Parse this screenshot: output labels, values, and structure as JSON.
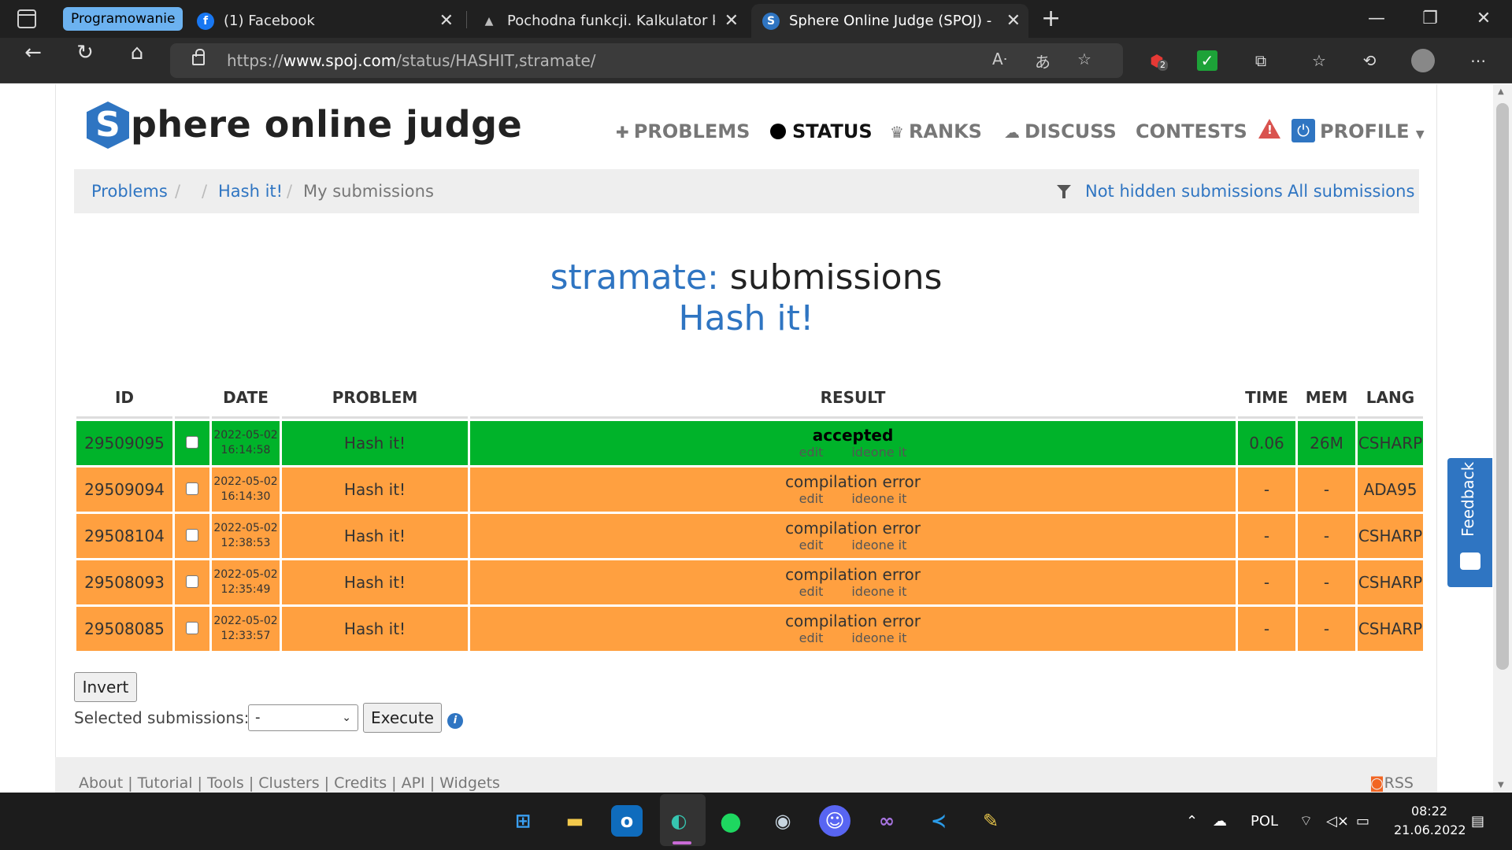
{
  "browser": {
    "tab_group": "Programowanie",
    "tabs": [
      {
        "title": "(1) Facebook",
        "icon": "facebook-icon"
      },
      {
        "title": "Pochodna funkcji. Kalkulator krok",
        "icon": "triangle-icon"
      },
      {
        "title": "Sphere Online Judge (SPOJ) - Sta",
        "icon": "spoj-icon",
        "active": true
      }
    ],
    "url_prefix": "https://",
    "url_domain": "www.spoj.com",
    "url_path": "/status/HASHIT,stramate/",
    "extension_badge": "2"
  },
  "site": {
    "logo_letter": "S",
    "logo_text": "phere online judge",
    "nav": {
      "problems": "PROBLEMS",
      "status": "STATUS",
      "ranks": "RANKS",
      "discuss": "DISCUSS",
      "contests": "CONTESTS",
      "profile": "PROFILE"
    }
  },
  "breadcrumb": {
    "problems": "Problems",
    "sep": "/",
    "problem": "Hash it!",
    "current": "My submissions",
    "not_hidden": "Not hidden submissions",
    "all": "All submissions"
  },
  "heading": {
    "user": "stramate:",
    "suffix": "submissions",
    "problem": "Hash it!"
  },
  "table": {
    "headers": {
      "id": "ID",
      "date": "DATE",
      "problem": "PROBLEM",
      "result": "RESULT",
      "time": "TIME",
      "mem": "MEM",
      "lang": "LANG"
    },
    "edit_label": "edit",
    "ideone_label": "ideone it",
    "rows": [
      {
        "id": "29509095",
        "date": "2022-05-02",
        "time_of_day": "16:14:58",
        "problem": "Hash it!",
        "result": "accepted",
        "time": "0.06",
        "mem": "26M",
        "lang": "CSHARP",
        "status": "ok"
      },
      {
        "id": "29509094",
        "date": "2022-05-02",
        "time_of_day": "16:14:30",
        "problem": "Hash it!",
        "result": "compilation error",
        "time": "-",
        "mem": "-",
        "lang": "ADA95",
        "status": "ce"
      },
      {
        "id": "29508104",
        "date": "2022-05-02",
        "time_of_day": "12:38:53",
        "problem": "Hash it!",
        "result": "compilation error",
        "time": "-",
        "mem": "-",
        "lang": "CSHARP",
        "status": "ce"
      },
      {
        "id": "29508093",
        "date": "2022-05-02",
        "time_of_day": "12:35:49",
        "problem": "Hash it!",
        "result": "compilation error",
        "time": "-",
        "mem": "-",
        "lang": "CSHARP",
        "status": "ce"
      },
      {
        "id": "29508085",
        "date": "2022-05-02",
        "time_of_day": "12:33:57",
        "problem": "Hash it!",
        "result": "compilation error",
        "time": "-",
        "mem": "-",
        "lang": "CSHARP",
        "status": "ce"
      }
    ]
  },
  "controls": {
    "invert": "Invert",
    "selected_label": "Selected submissions:",
    "select_value": "-",
    "execute": "Execute",
    "info": "i"
  },
  "footer": {
    "links": "About | Tutorial | Tools | Clusters | Credits | API | Widgets",
    "rss": "RSS"
  },
  "feedback": "Feedback",
  "taskbar": {
    "language": "POL",
    "time": "08:22",
    "date": "21.06.2022"
  },
  "colors": {
    "accepted": "#00b32a",
    "compilation_error": "#ffa040",
    "brand": "#2f75c2"
  }
}
